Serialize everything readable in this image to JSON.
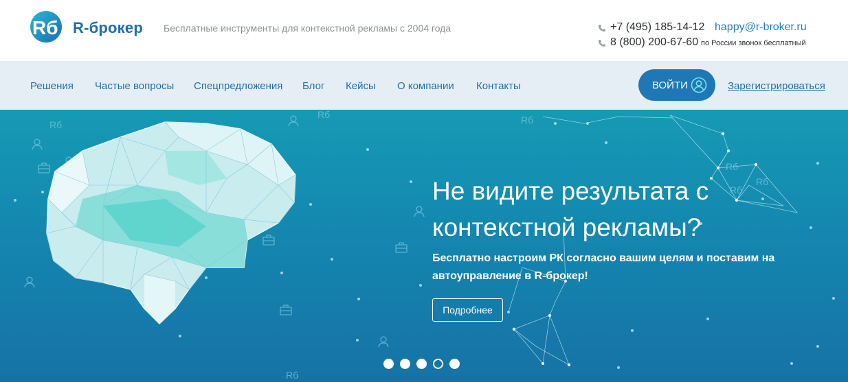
{
  "header": {
    "logo_mark": "Rб",
    "brand": "R-брокер",
    "tagline": "Бесплатные инструменты для контекстной рекламы с 2004 года",
    "phone1": "+7 (495) 185-14-12",
    "email": "happy@r-broker.ru",
    "phone2": "8 (800) 200-67-60",
    "phone2_note": "по России звонок бесплатный"
  },
  "nav": {
    "items": [
      "Решения",
      "Частые вопросы",
      "Спецпредложения",
      "Блог",
      "Кейсы",
      "О компании",
      "Контакты"
    ],
    "login": "ВОЙТИ",
    "register": "Зарегистрироваться"
  },
  "hero": {
    "title_line1": "Не видите результата с",
    "title_line2": "контекстной рекламы?",
    "subtitle_line1": "Бесплатно настроим РК согласно вашим целям и поставим на",
    "subtitle_line2": "автоуправление в R-брокер!",
    "button": "Подробнее",
    "watermark": "Rб",
    "slides": 5,
    "active_slide": 4
  },
  "colors": {
    "brand_blue": "#1e6fa8",
    "nav_bg": "#e6eef5",
    "button_blue": "#1e78b5",
    "hero_top": "#169ab4",
    "hero_bottom": "#1672a6"
  },
  "icons": [
    "phone-icon",
    "user-icon",
    "briefcase-icon",
    "brain-illustration"
  ]
}
